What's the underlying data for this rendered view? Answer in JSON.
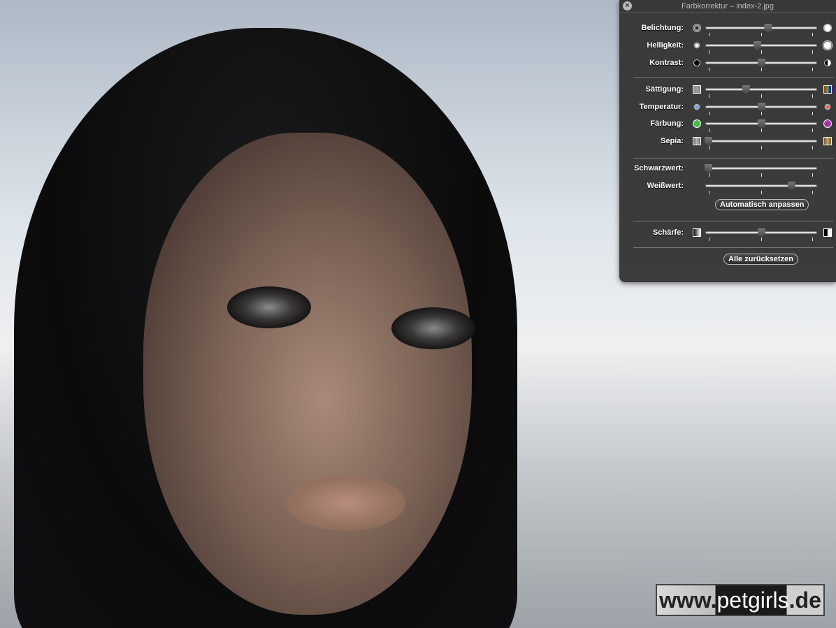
{
  "window": {
    "title": "Farbkorrektur – index-2.jpg"
  },
  "sliders": [
    {
      "label": "Belichtung:",
      "left_icon": "aperture-closed-icon",
      "right_icon": "aperture-open-icon",
      "value": 0.56
    },
    {
      "label": "Helligkeit:",
      "left_icon": "sun-small-icon",
      "right_icon": "sun-large-icon",
      "value": 0.46
    },
    {
      "label": "Kontrast:",
      "left_icon": "circle-black-icon",
      "right_icon": "circle-half-icon",
      "value": 0.5
    },
    {
      "label": "Sättigung:",
      "left_icon": "saturation-low-icon",
      "right_icon": "saturation-high-icon",
      "value": 0.36
    },
    {
      "label": "Temperatur:",
      "left_icon": "sun-cool-icon",
      "right_icon": "sun-warm-icon",
      "value": 0.5
    },
    {
      "label": "Färbung:",
      "left_icon": "green-circle-icon",
      "right_icon": "magenta-circle-icon",
      "value": 0.5
    },
    {
      "label": "Sepia:",
      "left_icon": "gray-swatch-icon",
      "right_icon": "sepia-swatch-icon",
      "value": 0.02
    },
    {
      "label": "Schwarzwert:",
      "value": 0.02
    },
    {
      "label": "Weißwert:",
      "value": 0.77
    },
    {
      "label": "Schärfe:",
      "left_icon": "sharpness-low-icon",
      "right_icon": "sharpness-high-icon",
      "value": 0.5
    }
  ],
  "buttons": {
    "auto": "Automatisch anpassen",
    "reset": "Alle zurücksetzen"
  },
  "watermark": {
    "prefix": "www.",
    "brand": "petgirls",
    ".suffix": ".de",
    "suffix": ".de"
  },
  "colors": {
    "panel": "#343434",
    "text": "#ffffff"
  }
}
